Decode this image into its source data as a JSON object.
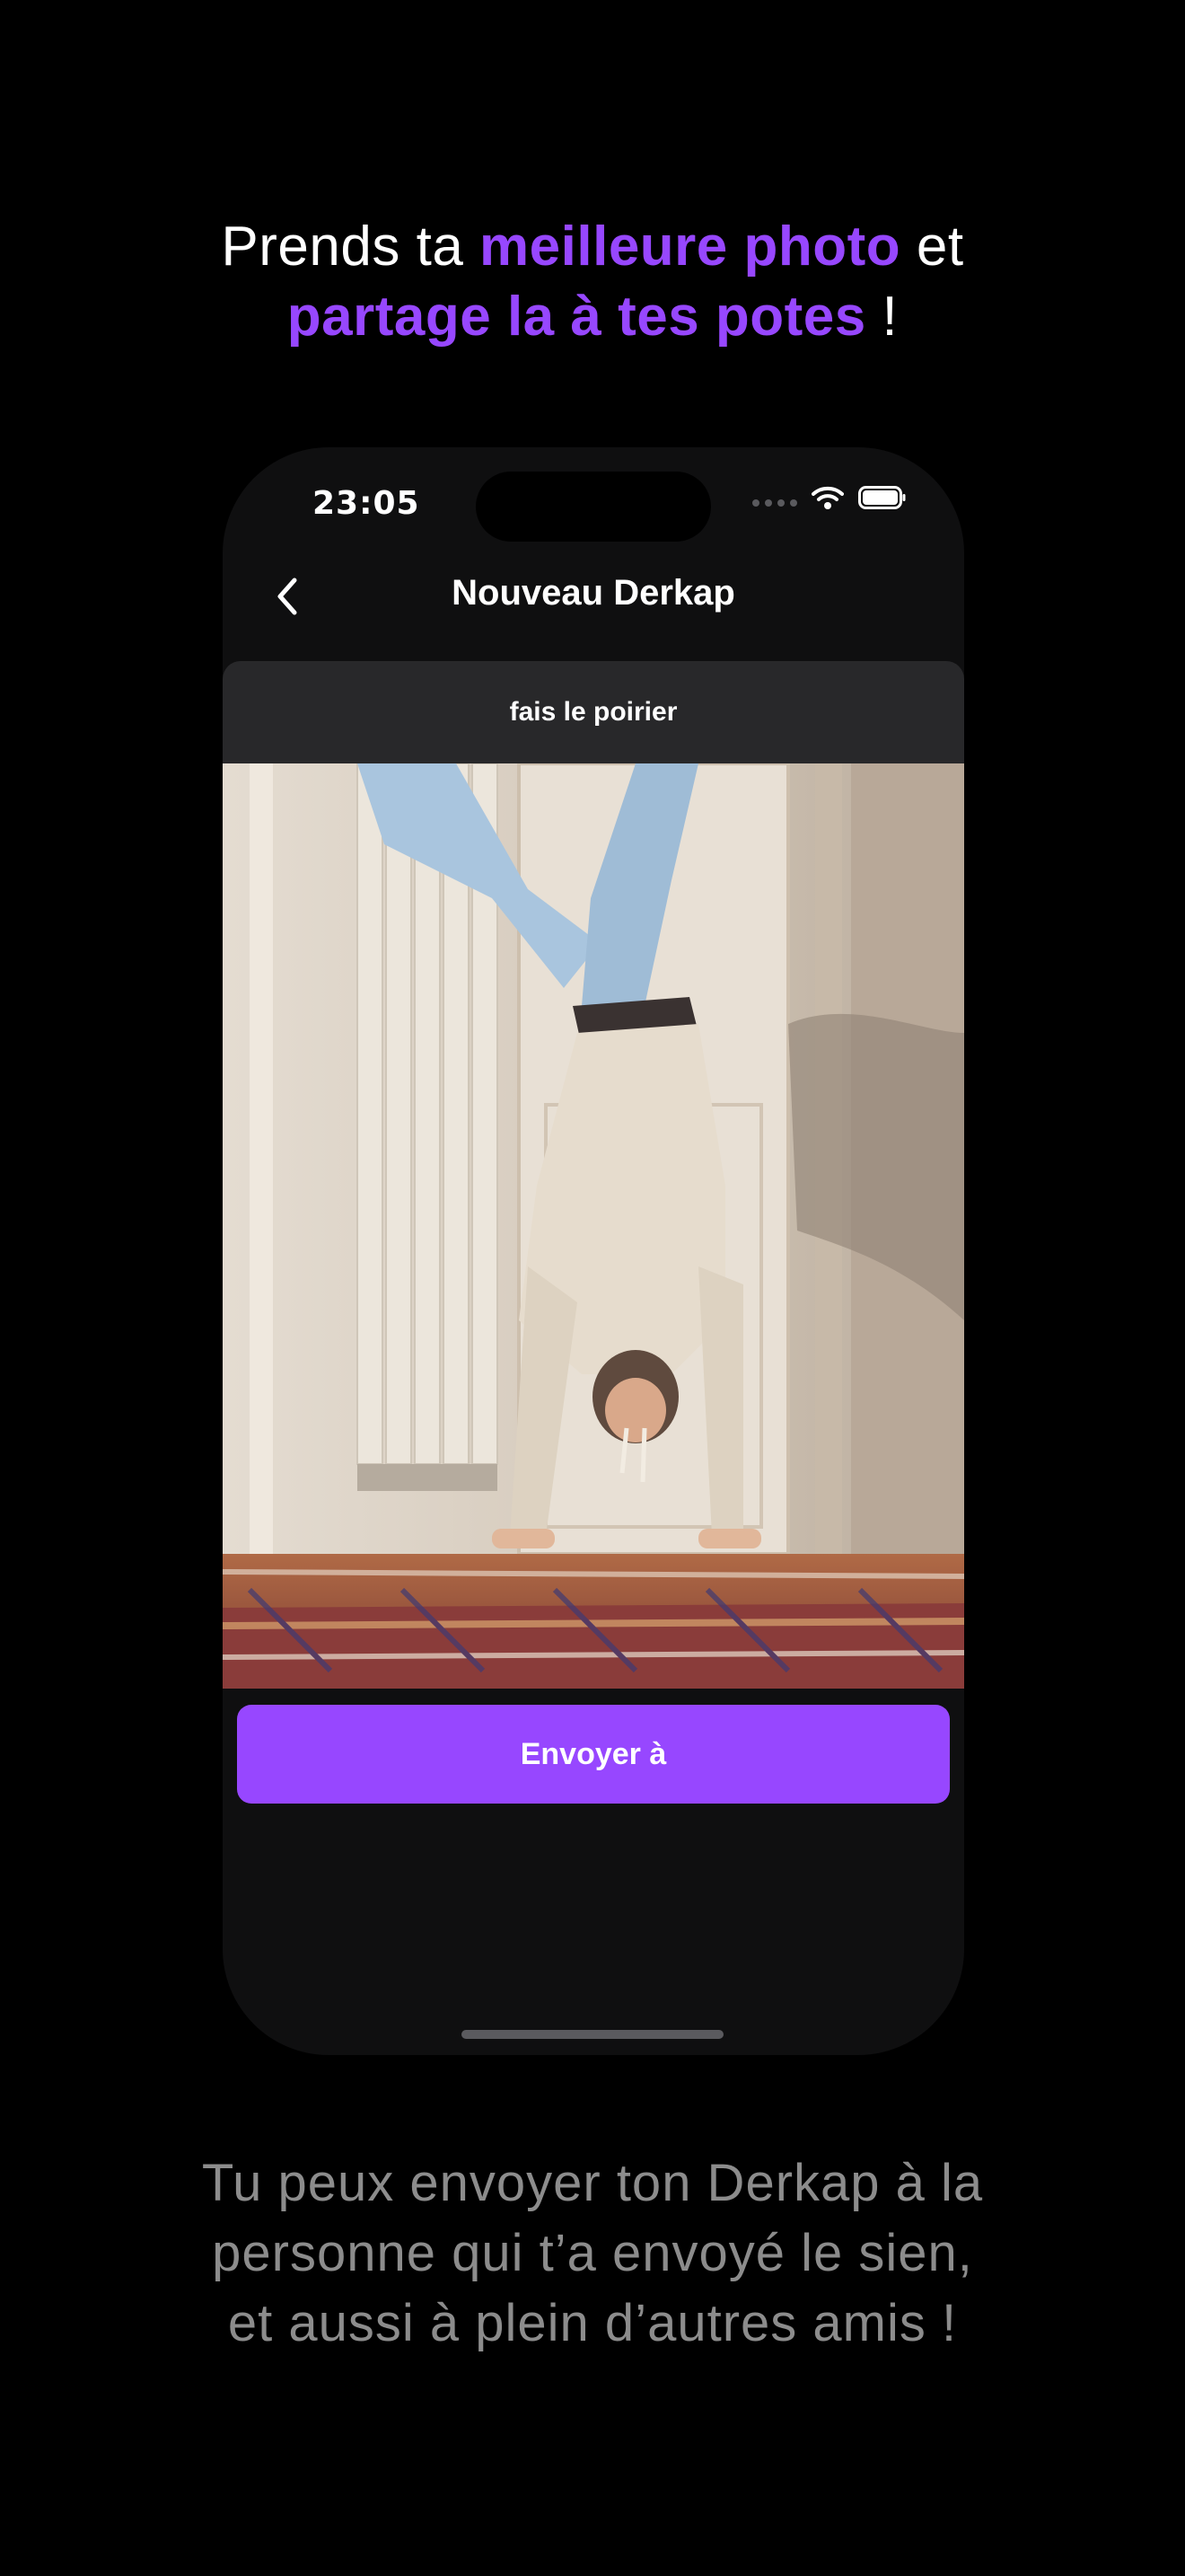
{
  "headline": {
    "part1": "Prends ta ",
    "accent1": "meilleure photo",
    "part2": " et",
    "accent2": "partage la à tes potes",
    "part3": " !"
  },
  "status_bar": {
    "time": "23:05",
    "icons": [
      "signal-dots-icon",
      "wifi-icon",
      "battery-icon"
    ]
  },
  "nav": {
    "back_icon": "chevron-left-icon",
    "title": "Nouveau Derkap"
  },
  "challenge": {
    "title": "fais le poirier"
  },
  "photo": {
    "description_icon": "photo-handstand"
  },
  "actions": {
    "send_label": "Envoyer à"
  },
  "caption": {
    "line1": "Tu peux envoyer ton Derkap à la",
    "line2": "personne qui t’a envoyé le sien,",
    "line3": "et aussi à plein d’autres amis !"
  },
  "colors": {
    "accent": "#9747ff",
    "background": "#000000",
    "phone": "#0f0f10",
    "card_header": "#28282a",
    "caption": "#8c8c8c"
  }
}
